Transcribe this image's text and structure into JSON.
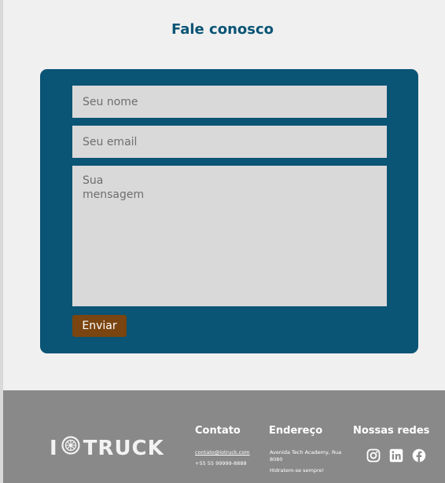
{
  "page": {
    "title": "Fale conosco"
  },
  "form": {
    "name_placeholder": "Seu nome",
    "email_placeholder": "Seu email",
    "message_placeholder": "Sua\nmensagem",
    "submit_label": "Enviar"
  },
  "footer": {
    "logo_text_start": "I",
    "logo_text_end": "TRUCK",
    "contact": {
      "title": "Contato",
      "email": "contato@iotruck.com",
      "phone": "+55 55 99999-8888"
    },
    "address": {
      "title": "Endereço",
      "line": "Avenida Tech Academy, Rua 8080",
      "slogan": "Hidratem-se sempre!"
    },
    "socials": {
      "title": "Nossas redes",
      "icons": [
        "instagram-icon",
        "linkedin-icon",
        "facebook-icon"
      ]
    }
  },
  "colors": {
    "brand_blue": "#0a5475",
    "button_brown": "#7a4510",
    "footer_gray": "#898989",
    "field_gray": "#d9d9d9",
    "page_bg": "#f0f0f0"
  }
}
